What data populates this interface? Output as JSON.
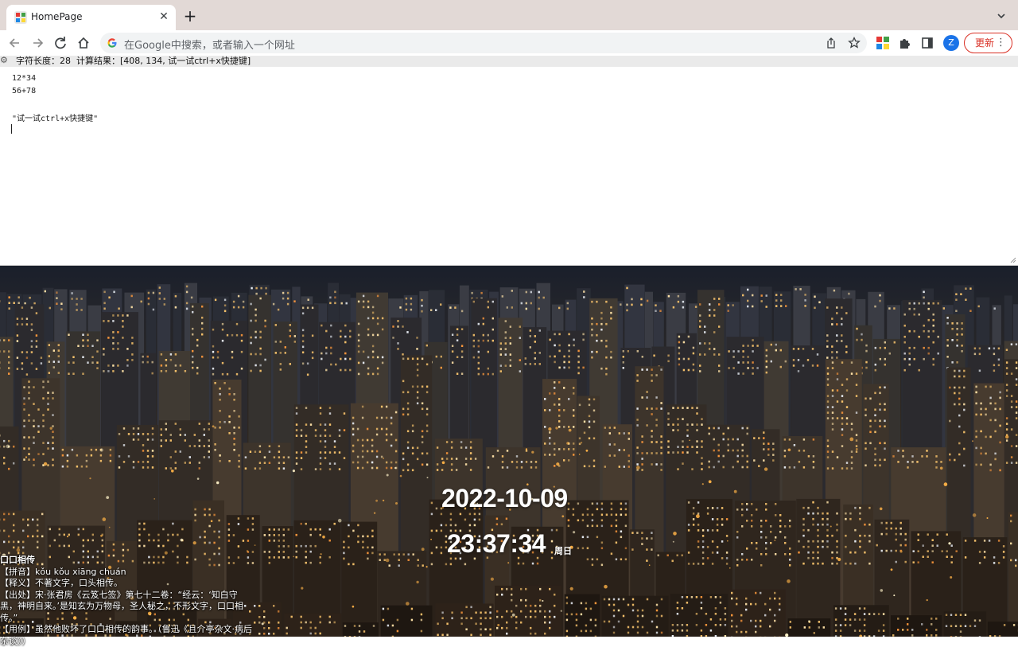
{
  "browser": {
    "tab_title": "HomePage",
    "new_tab_icon": "plus-icon",
    "omnibox_placeholder": "在Google中搜索，或者输入一个网址",
    "profile_initial": "Z",
    "update_label": "更新",
    "menu_label": "⋮"
  },
  "status": {
    "text": "字符长度：28  计算结果：[408, 134, 试一试ctrl+x快捷键]"
  },
  "editor": {
    "lines": [
      "12*34",
      "56+78",
      "",
      "\"试一试ctrl+x快捷键\""
    ]
  },
  "clock": {
    "date": "2022-10-09",
    "time": "23:37:34",
    "weekday": "周日"
  },
  "idiom": {
    "title": "口口相传",
    "pinyin": "【拼音】kǒu kǒu xiāng chuán",
    "meaning": "【释义】不著文字，口头相传。",
    "source": "【出处】宋·张君房《云笈七签》第七十二卷：“经云：‘知白守黑，神明自来。’是知玄为万物母，圣人秘之，不形文字，口口相传。”",
    "example": "【用例】虽然他败坏了口口相传的韵事。（鲁迅《且介亭杂文·病后杂谈》）"
  },
  "colors": {
    "update_red": "#d93025",
    "profile_blue": "#1a73e8",
    "tabbar_bg": "#e2d9d6"
  }
}
